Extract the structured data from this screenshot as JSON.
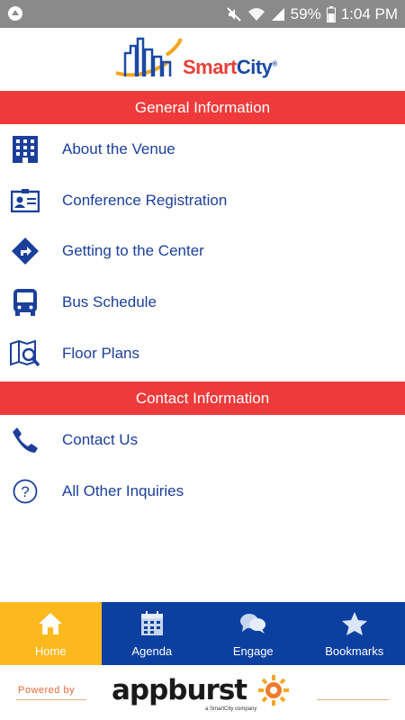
{
  "status_bar": {
    "battery_percent": "59%",
    "time": "1:04 PM",
    "icons": [
      "notification-app-icon",
      "mute-icon",
      "wifi-icon",
      "signal-icon",
      "battery-icon"
    ]
  },
  "header": {
    "logo_text_part1": "Smart",
    "logo_text_part2": "City",
    "logo_mark": "®"
  },
  "sections": [
    {
      "title": "General Information",
      "items": [
        {
          "label": "About the Venue",
          "icon": "building-icon"
        },
        {
          "label": "Conference Registration",
          "icon": "id-card-icon"
        },
        {
          "label": "Getting to the Center",
          "icon": "directions-icon"
        },
        {
          "label": "Bus Schedule",
          "icon": "bus-icon"
        },
        {
          "label": "Floor Plans",
          "icon": "map-search-icon"
        }
      ]
    },
    {
      "title": "Contact Information",
      "items": [
        {
          "label": "Contact Us",
          "icon": "phone-icon"
        },
        {
          "label": "All Other Inquiries",
          "icon": "question-icon"
        }
      ]
    }
  ],
  "tabs": [
    {
      "label": "Home",
      "icon": "home-icon",
      "active": true
    },
    {
      "label": "Agenda",
      "icon": "calendar-icon",
      "active": false
    },
    {
      "label": "Engage",
      "icon": "chat-bubbles-icon",
      "active": false
    },
    {
      "label": "Bookmarks",
      "icon": "star-icon",
      "active": false
    }
  ],
  "footer": {
    "powered_by": "Powered by",
    "brand": "appburst",
    "brand_sub": "a SmartCity company"
  },
  "colors": {
    "accent_red": "#ee3a3a",
    "brand_blue": "#0b3fa0",
    "active_tab": "#fbb91d",
    "link_text": "#1b3f9a"
  }
}
